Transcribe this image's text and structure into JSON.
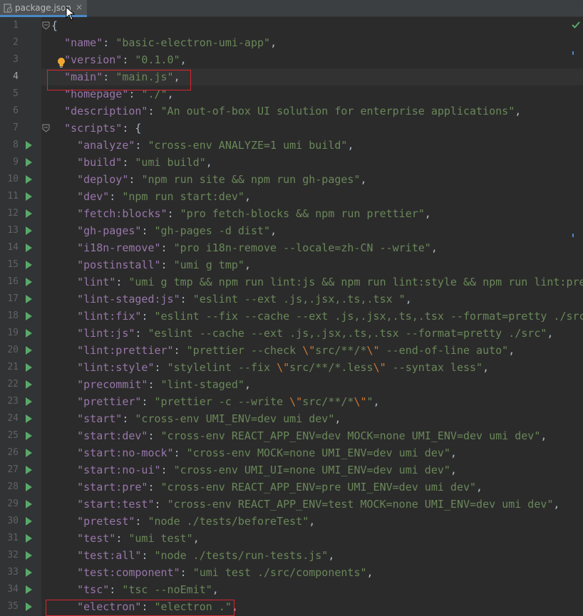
{
  "tab": {
    "label": "package.json",
    "close": "×"
  },
  "lines": [
    {
      "n": "1",
      "tokens": [
        {
          "t": "{",
          "c": "punct"
        }
      ]
    },
    {
      "n": "2",
      "tokens": [
        {
          "t": "  "
        },
        {
          "t": "\"name\"",
          "c": "key"
        },
        {
          "t": ": ",
          "c": "punct"
        },
        {
          "t": "\"basic-electron-umi-app\"",
          "c": "str"
        },
        {
          "t": ",",
          "c": "punct"
        }
      ]
    },
    {
      "n": "3",
      "tokens": [
        {
          "t": "  "
        },
        {
          "t": "\"version\"",
          "c": "key"
        },
        {
          "t": ": ",
          "c": "punct"
        },
        {
          "t": "\"0.1.0\"",
          "c": "str"
        },
        {
          "t": ",",
          "c": "punct"
        }
      ]
    },
    {
      "n": "4",
      "tokens": [
        {
          "t": "  "
        },
        {
          "t": "\"main\"",
          "c": "key"
        },
        {
          "t": ": ",
          "c": "punct"
        },
        {
          "t": "\"main.js\"",
          "c": "str"
        },
        {
          "t": ",",
          "c": "punct"
        }
      ]
    },
    {
      "n": "5",
      "tokens": [
        {
          "t": "  "
        },
        {
          "t": "\"homepage\"",
          "c": "key"
        },
        {
          "t": ": ",
          "c": "punct"
        },
        {
          "t": "\"./\"",
          "c": "str"
        },
        {
          "t": ",",
          "c": "punct"
        }
      ]
    },
    {
      "n": "6",
      "tokens": [
        {
          "t": "  "
        },
        {
          "t": "\"description\"",
          "c": "key"
        },
        {
          "t": ": ",
          "c": "punct"
        },
        {
          "t": "\"An out-of-box UI solution for enterprise applications\"",
          "c": "str"
        },
        {
          "t": ",",
          "c": "punct"
        }
      ]
    },
    {
      "n": "7",
      "tokens": [
        {
          "t": "  "
        },
        {
          "t": "\"scripts\"",
          "c": "key"
        },
        {
          "t": ": {",
          "c": "punct"
        }
      ]
    },
    {
      "n": "8",
      "tokens": [
        {
          "t": "    "
        },
        {
          "t": "\"analyze\"",
          "c": "key"
        },
        {
          "t": ": ",
          "c": "punct"
        },
        {
          "t": "\"cross-env ANALYZE=1 umi build\"",
          "c": "str"
        },
        {
          "t": ",",
          "c": "punct"
        }
      ]
    },
    {
      "n": "9",
      "tokens": [
        {
          "t": "    "
        },
        {
          "t": "\"build\"",
          "c": "key"
        },
        {
          "t": ": ",
          "c": "punct"
        },
        {
          "t": "\"umi build\"",
          "c": "str"
        },
        {
          "t": ",",
          "c": "punct"
        }
      ]
    },
    {
      "n": "10",
      "tokens": [
        {
          "t": "    "
        },
        {
          "t": "\"deploy\"",
          "c": "key"
        },
        {
          "t": ": ",
          "c": "punct"
        },
        {
          "t": "\"npm run site && npm run gh-pages\"",
          "c": "str"
        },
        {
          "t": ",",
          "c": "punct"
        }
      ]
    },
    {
      "n": "11",
      "tokens": [
        {
          "t": "    "
        },
        {
          "t": "\"dev\"",
          "c": "key"
        },
        {
          "t": ": ",
          "c": "punct"
        },
        {
          "t": "\"npm run start:dev\"",
          "c": "str"
        },
        {
          "t": ",",
          "c": "punct"
        }
      ]
    },
    {
      "n": "12",
      "tokens": [
        {
          "t": "    "
        },
        {
          "t": "\"fetch:blocks\"",
          "c": "key"
        },
        {
          "t": ": ",
          "c": "punct"
        },
        {
          "t": "\"pro fetch-blocks && npm run prettier\"",
          "c": "str"
        },
        {
          "t": ",",
          "c": "punct"
        }
      ]
    },
    {
      "n": "13",
      "tokens": [
        {
          "t": "    "
        },
        {
          "t": "\"gh-pages\"",
          "c": "key"
        },
        {
          "t": ": ",
          "c": "punct"
        },
        {
          "t": "\"gh-pages -d dist\"",
          "c": "str"
        },
        {
          "t": ",",
          "c": "punct"
        }
      ]
    },
    {
      "n": "14",
      "tokens": [
        {
          "t": "    "
        },
        {
          "t": "\"i18n-remove\"",
          "c": "key"
        },
        {
          "t": ": ",
          "c": "punct"
        },
        {
          "t": "\"pro i18n-remove --locale=zh-CN --write\"",
          "c": "str"
        },
        {
          "t": ",",
          "c": "punct"
        }
      ]
    },
    {
      "n": "15",
      "tokens": [
        {
          "t": "    "
        },
        {
          "t": "\"postinstall\"",
          "c": "key"
        },
        {
          "t": ": ",
          "c": "punct"
        },
        {
          "t": "\"umi g tmp\"",
          "c": "str"
        },
        {
          "t": ",",
          "c": "punct"
        }
      ]
    },
    {
      "n": "16",
      "tokens": [
        {
          "t": "    "
        },
        {
          "t": "\"lint\"",
          "c": "key"
        },
        {
          "t": ": ",
          "c": "punct"
        },
        {
          "t": "\"umi g tmp && npm run lint:js && npm run lint:style && npm run lint:pre",
          "c": "str"
        }
      ]
    },
    {
      "n": "17",
      "tokens": [
        {
          "t": "    "
        },
        {
          "t": "\"lint-staged:js\"",
          "c": "key"
        },
        {
          "t": ": ",
          "c": "punct"
        },
        {
          "t": "\"eslint --ext .js,.jsx,.ts,.tsx \"",
          "c": "str"
        },
        {
          "t": ",",
          "c": "punct"
        }
      ]
    },
    {
      "n": "18",
      "tokens": [
        {
          "t": "    "
        },
        {
          "t": "\"lint:fix\"",
          "c": "key"
        },
        {
          "t": ": ",
          "c": "punct"
        },
        {
          "t": "\"eslint --fix --cache --ext .js,.jsx,.ts,.tsx --format=pretty ./src",
          "c": "str"
        }
      ]
    },
    {
      "n": "19",
      "tokens": [
        {
          "t": "    "
        },
        {
          "t": "\"lint:js\"",
          "c": "key"
        },
        {
          "t": ": ",
          "c": "punct"
        },
        {
          "t": "\"eslint --cache --ext .js,.jsx,.ts,.tsx --format=pretty ./src\"",
          "c": "str"
        },
        {
          "t": ",",
          "c": "punct"
        }
      ]
    },
    {
      "n": "20",
      "tokens": [
        {
          "t": "    "
        },
        {
          "t": "\"lint:prettier\"",
          "c": "key"
        },
        {
          "t": ": ",
          "c": "punct"
        },
        {
          "t": "\"prettier --check ",
          "c": "str"
        },
        {
          "t": "\\\"",
          "c": "esc"
        },
        {
          "t": "src/**/*",
          "c": "str"
        },
        {
          "t": "\\\"",
          "c": "esc"
        },
        {
          "t": " --end-of-line auto\"",
          "c": "str"
        },
        {
          "t": ",",
          "c": "punct"
        }
      ]
    },
    {
      "n": "21",
      "tokens": [
        {
          "t": "    "
        },
        {
          "t": "\"lint:style\"",
          "c": "key"
        },
        {
          "t": ": ",
          "c": "punct"
        },
        {
          "t": "\"stylelint --fix ",
          "c": "str"
        },
        {
          "t": "\\\"",
          "c": "esc"
        },
        {
          "t": "src/**/*.less",
          "c": "str"
        },
        {
          "t": "\\\"",
          "c": "esc"
        },
        {
          "t": " --syntax less\"",
          "c": "str"
        },
        {
          "t": ",",
          "c": "punct"
        }
      ]
    },
    {
      "n": "22",
      "tokens": [
        {
          "t": "    "
        },
        {
          "t": "\"precommit\"",
          "c": "key"
        },
        {
          "t": ": ",
          "c": "punct"
        },
        {
          "t": "\"lint-staged\"",
          "c": "str"
        },
        {
          "t": ",",
          "c": "punct"
        }
      ]
    },
    {
      "n": "23",
      "tokens": [
        {
          "t": "    "
        },
        {
          "t": "\"prettier\"",
          "c": "key"
        },
        {
          "t": ": ",
          "c": "punct"
        },
        {
          "t": "\"prettier -c --write ",
          "c": "str"
        },
        {
          "t": "\\\"",
          "c": "esc"
        },
        {
          "t": "src/**/*",
          "c": "str"
        },
        {
          "t": "\\\"",
          "c": "esc"
        },
        {
          "t": "\"",
          "c": "str"
        },
        {
          "t": ",",
          "c": "punct"
        }
      ]
    },
    {
      "n": "24",
      "tokens": [
        {
          "t": "    "
        },
        {
          "t": "\"start\"",
          "c": "key"
        },
        {
          "t": ": ",
          "c": "punct"
        },
        {
          "t": "\"cross-env UMI_ENV=dev umi dev\"",
          "c": "str"
        },
        {
          "t": ",",
          "c": "punct"
        }
      ]
    },
    {
      "n": "25",
      "tokens": [
        {
          "t": "    "
        },
        {
          "t": "\"start:dev\"",
          "c": "key"
        },
        {
          "t": ": ",
          "c": "punct"
        },
        {
          "t": "\"cross-env REACT_APP_ENV=dev MOCK=none UMI_ENV=dev umi dev\"",
          "c": "str"
        },
        {
          "t": ",",
          "c": "punct"
        }
      ]
    },
    {
      "n": "26",
      "tokens": [
        {
          "t": "    "
        },
        {
          "t": "\"start:no-mock\"",
          "c": "key"
        },
        {
          "t": ": ",
          "c": "punct"
        },
        {
          "t": "\"cross-env MOCK=none UMI_ENV=dev umi dev\"",
          "c": "str"
        },
        {
          "t": ",",
          "c": "punct"
        }
      ]
    },
    {
      "n": "27",
      "tokens": [
        {
          "t": "    "
        },
        {
          "t": "\"start:no-ui\"",
          "c": "key"
        },
        {
          "t": ": ",
          "c": "punct"
        },
        {
          "t": "\"cross-env UMI_UI=none UMI_ENV=dev umi dev\"",
          "c": "str"
        },
        {
          "t": ",",
          "c": "punct"
        }
      ]
    },
    {
      "n": "28",
      "tokens": [
        {
          "t": "    "
        },
        {
          "t": "\"start:pre\"",
          "c": "key"
        },
        {
          "t": ": ",
          "c": "punct"
        },
        {
          "t": "\"cross-env REACT_APP_ENV=pre UMI_ENV=dev umi dev\"",
          "c": "str"
        },
        {
          "t": ",",
          "c": "punct"
        }
      ]
    },
    {
      "n": "29",
      "tokens": [
        {
          "t": "    "
        },
        {
          "t": "\"start:test\"",
          "c": "key"
        },
        {
          "t": ": ",
          "c": "punct"
        },
        {
          "t": "\"cross-env REACT_APP_ENV=test MOCK=none UMI_ENV=dev umi dev\"",
          "c": "str"
        },
        {
          "t": ",",
          "c": "punct"
        }
      ]
    },
    {
      "n": "30",
      "tokens": [
        {
          "t": "    "
        },
        {
          "t": "\"pretest\"",
          "c": "key"
        },
        {
          "t": ": ",
          "c": "punct"
        },
        {
          "t": "\"node ./tests/beforeTest\"",
          "c": "str"
        },
        {
          "t": ",",
          "c": "punct"
        }
      ]
    },
    {
      "n": "31",
      "tokens": [
        {
          "t": "    "
        },
        {
          "t": "\"test\"",
          "c": "key"
        },
        {
          "t": ": ",
          "c": "punct"
        },
        {
          "t": "\"umi test\"",
          "c": "str"
        },
        {
          "t": ",",
          "c": "punct"
        }
      ]
    },
    {
      "n": "32",
      "tokens": [
        {
          "t": "    "
        },
        {
          "t": "\"test:all\"",
          "c": "key"
        },
        {
          "t": ": ",
          "c": "punct"
        },
        {
          "t": "\"node ./tests/run-tests.js\"",
          "c": "str"
        },
        {
          "t": ",",
          "c": "punct"
        }
      ]
    },
    {
      "n": "33",
      "tokens": [
        {
          "t": "    "
        },
        {
          "t": "\"test:component\"",
          "c": "key"
        },
        {
          "t": ": ",
          "c": "punct"
        },
        {
          "t": "\"umi test ./src/components\"",
          "c": "str"
        },
        {
          "t": ",",
          "c": "punct"
        }
      ]
    },
    {
      "n": "34",
      "tokens": [
        {
          "t": "    "
        },
        {
          "t": "\"tsc\"",
          "c": "key"
        },
        {
          "t": ": ",
          "c": "punct"
        },
        {
          "t": "\"tsc --noEmit\"",
          "c": "str"
        },
        {
          "t": ",",
          "c": "punct"
        }
      ]
    },
    {
      "n": "35",
      "tokens": [
        {
          "t": "    "
        },
        {
          "t": "\"electron\"",
          "c": "key"
        },
        {
          "t": ": ",
          "c": "punct"
        },
        {
          "t": "\"electron .\"",
          "c": "str"
        },
        {
          "t": ",",
          "c": "punct"
        }
      ]
    }
  ],
  "run_lines": [
    8,
    9,
    10,
    11,
    12,
    13,
    14,
    15,
    16,
    17,
    18,
    19,
    20,
    21,
    22,
    23,
    24,
    25,
    26,
    27,
    28,
    29,
    30,
    31,
    32,
    33,
    34,
    35
  ],
  "fold_lines": [
    1,
    7
  ],
  "current_line": 4,
  "colors": {
    "key": "#9876aa",
    "string": "#6a8759",
    "escape": "#cc7832",
    "highlight": "#d9252f",
    "run": "#59a869"
  }
}
